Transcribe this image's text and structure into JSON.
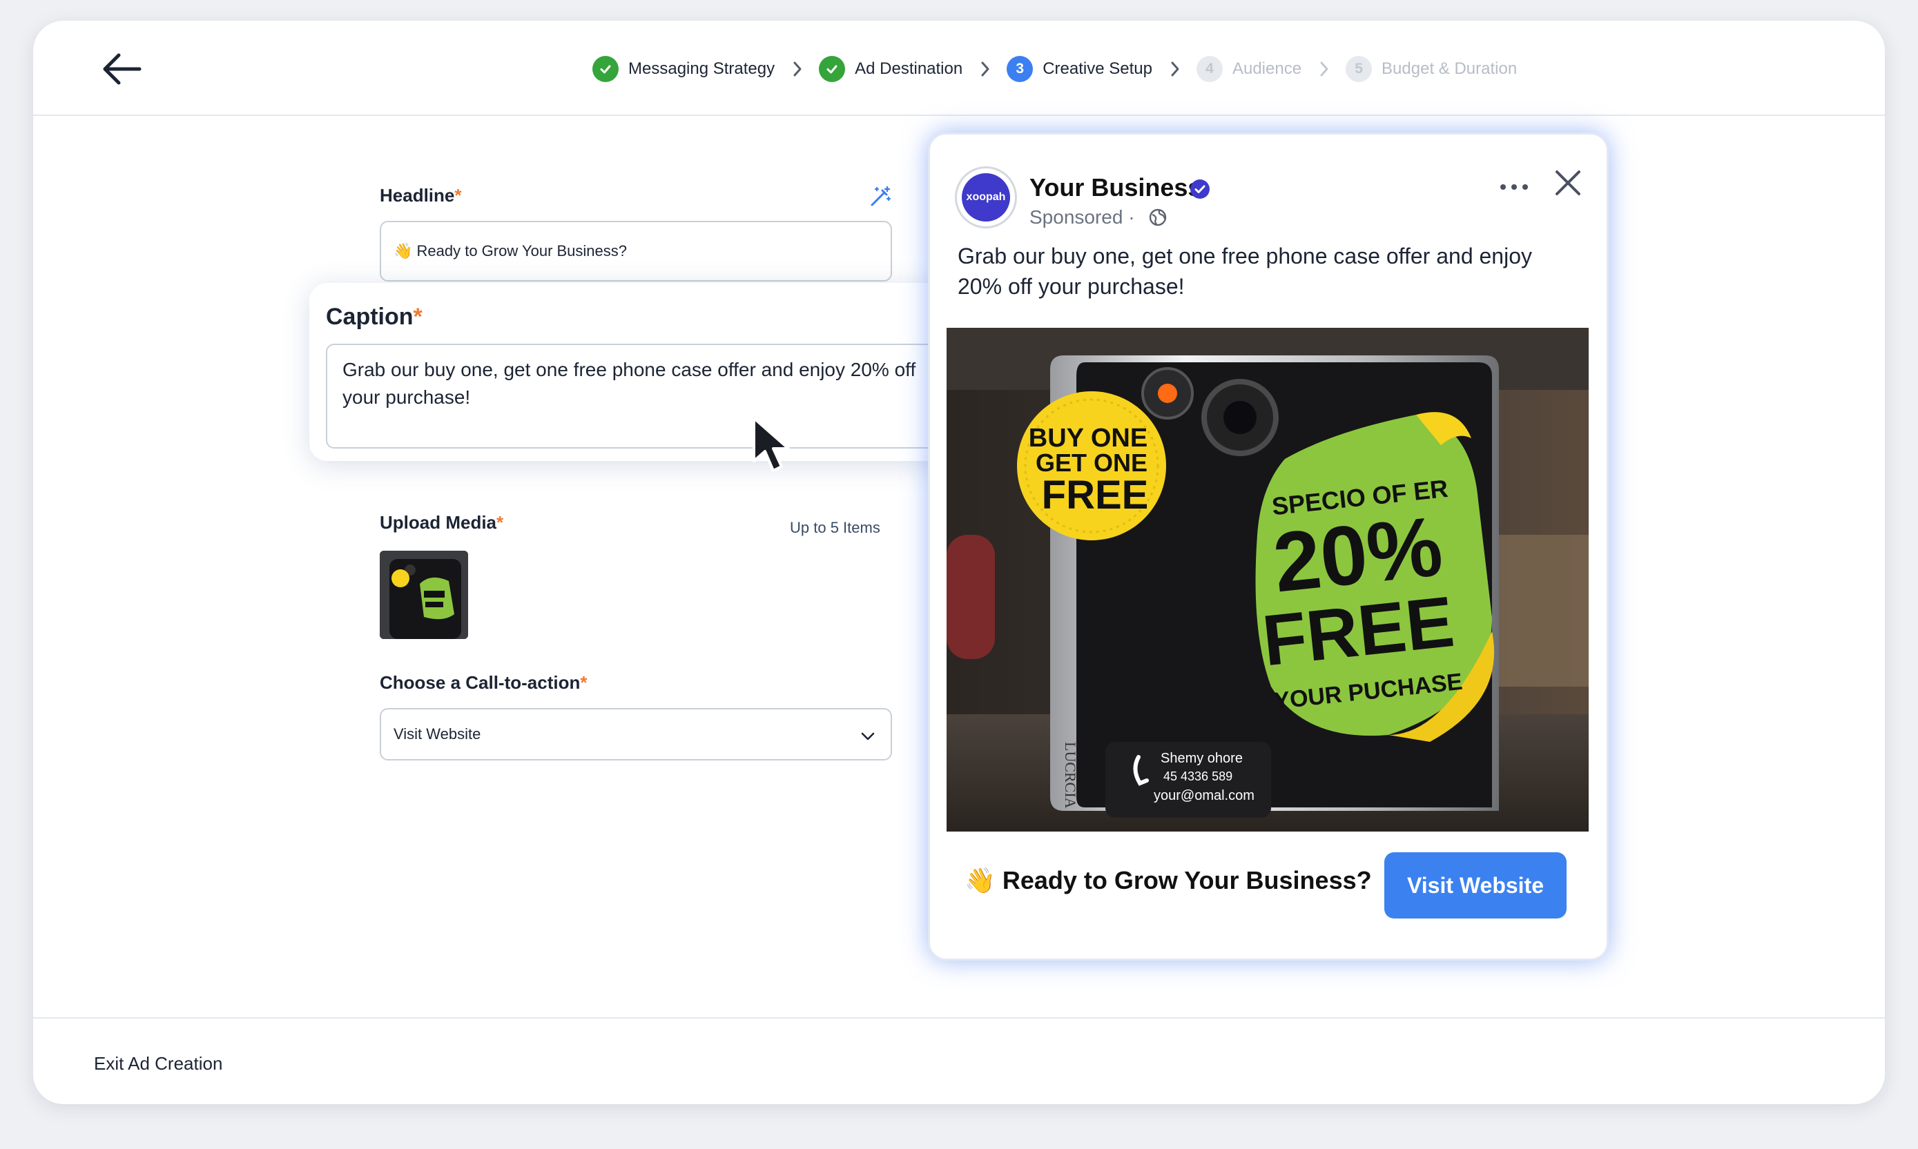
{
  "nav": {
    "steps": [
      {
        "number": "1",
        "label": "Messaging Strategy",
        "state": "done"
      },
      {
        "number": "2",
        "label": "Ad Destination",
        "state": "done"
      },
      {
        "number": "3",
        "label": "Creative Setup",
        "state": "active"
      },
      {
        "number": "4",
        "label": "Audience",
        "state": "future"
      },
      {
        "number": "5",
        "label": "Budget & Duration",
        "state": "future"
      }
    ]
  },
  "form": {
    "headline_label": "Headline",
    "headline_value": "👋 Ready to Grow Your Business?",
    "caption_label": "Caption",
    "caption_value": "Grab our buy one, get one free phone case offer and enjoy 20% off your purchase!",
    "required_mark": "*",
    "upload_label": "Upload Media",
    "upload_hint": "Up to 5 Items",
    "cta_label": "Choose a Call-to-action",
    "cta_value": "Visit Website"
  },
  "preview": {
    "business_name": "Your Business",
    "avatar_text": "xoopah",
    "sponsored": "Sponsored ·",
    "post_text": "Grab our buy one, get one free phone case offer and enjoy 20% off your purchase!",
    "headline": "👋 Ready to Grow Your Business?",
    "cta_button": "Visit Website",
    "image_text": {
      "badge_line1": "BUY ONE",
      "badge_line2": "GET ONE",
      "badge_line3": "FREE",
      "sticker_line1": "SPECIO OF ER",
      "sticker_line2": "20%",
      "sticker_line3": "FREE",
      "sticker_line4": "YOUR PUCHASE",
      "contact_name": "Shemy ohore",
      "contact_phone": "45 4336 589",
      "contact_email": "your@omal.com",
      "brand_vertical": "LUCRCIA"
    }
  },
  "footer": {
    "exit_label": "Exit Ad Creation"
  },
  "colors": {
    "accent": "#3b82f0",
    "done": "#35a43a",
    "required": "#f07a2f",
    "sticker_green": "#8cc63f",
    "badge_yellow": "#f7d31e"
  }
}
